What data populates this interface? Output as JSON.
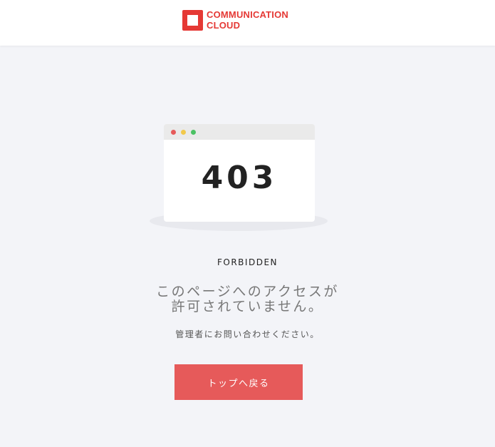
{
  "header": {
    "logo_line1": "COMMUNICATION",
    "logo_line2": "CLOUD",
    "brand_color": "#e53935"
  },
  "illustration": {
    "code": "403",
    "window_dots": [
      "#e65a5a",
      "#f2c94c",
      "#4cc264"
    ]
  },
  "error": {
    "label": "FORBIDDEN",
    "message_line1": "このページへのアクセスが",
    "message_line2": "許可されていません。",
    "sub_message": "管理者にお問い合わせください。"
  },
  "actions": {
    "back_to_top": "トップへ戻る",
    "button_color": "#e65a5a"
  }
}
